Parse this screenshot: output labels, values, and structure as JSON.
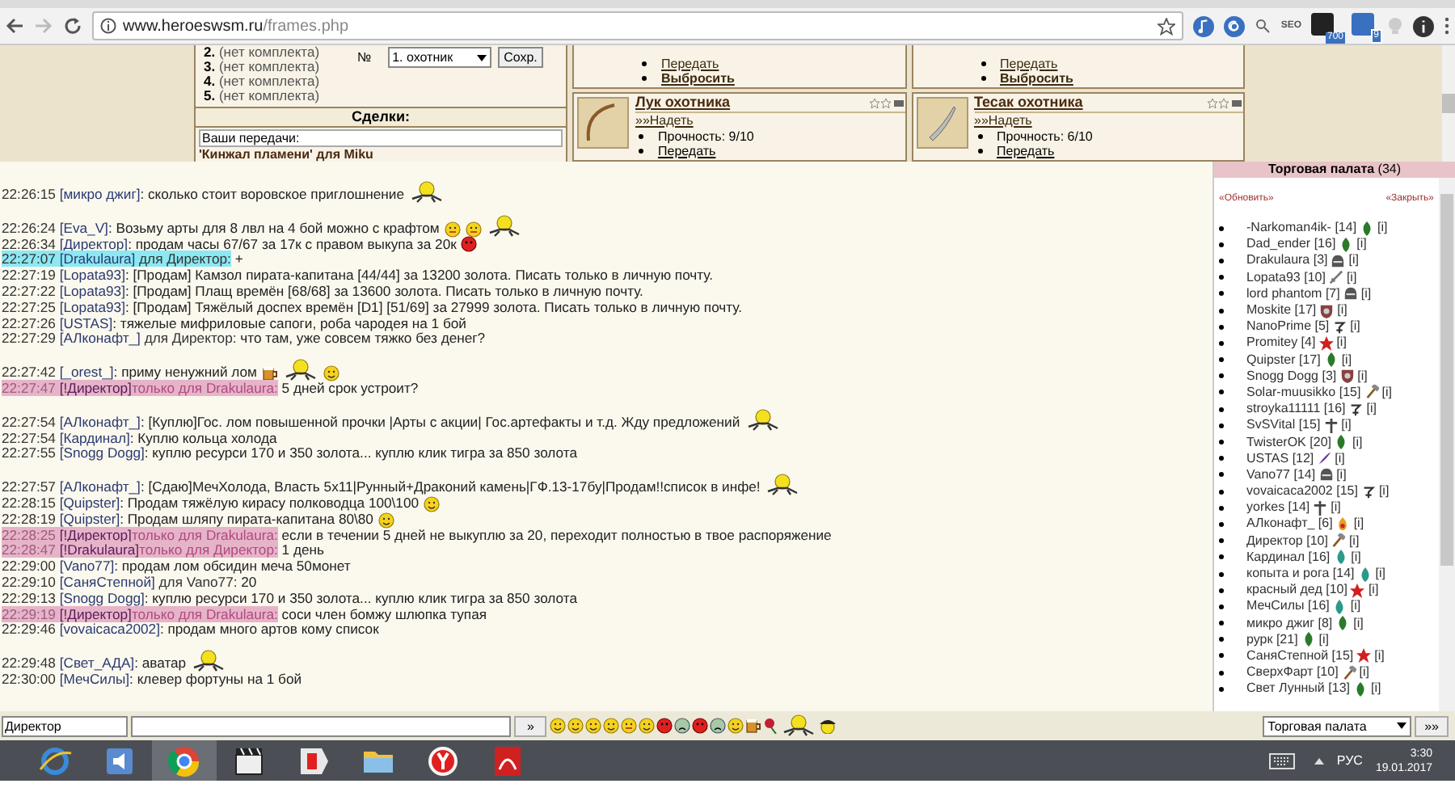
{
  "browser": {
    "url_host": "www.heroeswsm.ru",
    "url_path": "/frames.php",
    "ext_label": "SEO",
    "badges": [
      "700",
      "9"
    ]
  },
  "outfits": {
    "items": [
      {
        "num": "2.",
        "text": "(нет комплекта)"
      },
      {
        "num": "3.",
        "text": "(нет комплекта)"
      },
      {
        "num": "4.",
        "text": "(нет комплекта)"
      },
      {
        "num": "5.",
        "text": "(нет комплекта)"
      }
    ],
    "num_label": "№",
    "select": "1. охотник",
    "save": "Сохр.",
    "deals_title": "Сделки:",
    "transfers": "Ваши передачи:",
    "transfer_item": "'Кинжал пламени' для Miku"
  },
  "items_top": [
    {
      "actions": [
        "Передать",
        "Выбросить"
      ]
    },
    {
      "actions": [
        "Передать",
        "Выбросить"
      ]
    }
  ],
  "items": [
    {
      "name": "Лук охотника",
      "kind": "bow",
      "equip": "»»Надеть",
      "durability": "Прочность: 9/10",
      "action": "Передать"
    },
    {
      "name": "Тесак охотника",
      "kind": "blade",
      "equip": "»»Надеть",
      "durability": "Прочность: 6/10",
      "action": "Передать"
    }
  ],
  "chat_blocks": [
    {
      "messages": [
        {
          "time": "22:26:15",
          "nick": "[микро джиг]",
          "text": ": сколько стоит воровское приглошнение",
          "kind": "public",
          "emotes": [
            {
              "kind": "crawler"
            }
          ]
        }
      ]
    },
    {
      "messages": [
        {
          "time": "22:26:24",
          "nick": "[Eva_V]",
          "text": ": Возьму арты для 8 лвл на 4 бой можно с крафтом",
          "kind": "public",
          "emotes": [
            {
              "kind": "tongue"
            },
            {
              "kind": "tongue"
            },
            {
              "kind": "crawler"
            }
          ]
        },
        {
          "time": "22:26:34",
          "nick": "[Директор]",
          "text": ": продам часы 67/67 за 17к с правом выкупа за 20к",
          "kind": "public",
          "emotes": [
            {
              "kind": "angry"
            }
          ]
        },
        {
          "time": "22:27:07",
          "nick": "[Drakulaura]",
          "to": " для Директор:",
          "text": " +",
          "kind": "mention"
        },
        {
          "time": "22:27:19",
          "nick": "[Lopata93]",
          "text": ": [Продам] Камзол пирата-капитана [44/44] за 13200 золота. Писать только в личную почту.",
          "kind": "public"
        },
        {
          "time": "22:27:22",
          "nick": "[Lopata93]",
          "text": ": [Продам] Плащ времён [68/68] за 13600 золота. Писать только в личную почту.",
          "kind": "public"
        },
        {
          "time": "22:27:25",
          "nick": "[Lopata93]",
          "text": ": [Продам] Тяжёлый доспех времён [D1] [51/69] за 27999 золота. Писать только в личную почту.",
          "kind": "public"
        },
        {
          "time": "22:27:26",
          "nick": "[USTAS]",
          "text": ": тяжелые мифриловые сапоги, роба чародея на 1 бой",
          "kind": "public"
        },
        {
          "time": "22:27:29",
          "nick": "[АЛконафт_]",
          "to": " для Директор:",
          "text": " что там, уже совсем тяжко без денег?",
          "kind": "public"
        }
      ]
    },
    {
      "messages": [
        {
          "time": "22:27:42",
          "nick": "[_orest_]",
          "text": ": приму ненужний лом",
          "kind": "public",
          "emotes": [
            {
              "kind": "beer"
            },
            {
              "kind": "crawler"
            },
            {
              "kind": "smiley"
            }
          ]
        },
        {
          "time": "22:27:47",
          "nick": "[!Директор]",
          "to": "только для Drakulaura:",
          "text": " 5 дней срок устроит?",
          "kind": "private"
        }
      ]
    },
    {
      "messages": [
        {
          "time": "22:27:54",
          "nick": "[АЛконафт_]",
          "text": ": [Куплю]Гос. лом повышенной прочки |Арты с акции| Гос.артефакты и т.д. Жду предложений",
          "kind": "public",
          "emotes": [
            {
              "kind": "crawler"
            }
          ]
        },
        {
          "time": "22:27:54",
          "nick": "[Кардинал]",
          "text": ": Куплю кольца холода",
          "kind": "public"
        },
        {
          "time": "22:27:55",
          "nick": "[Snogg Dogg]",
          "text": ": куплю ресурси 170 и 350 золота... куплю клик тигра за 850 золота",
          "kind": "public"
        }
      ]
    },
    {
      "messages": [
        {
          "time": "22:27:57",
          "nick": "[АЛконафт_]",
          "text": ": [Сдаю]МечХолода, Власть 5х11|Рунный+Драконий камень|ГФ.13-17бу|Продам!!список в инфе!",
          "kind": "public",
          "emotes": [
            {
              "kind": "crawler"
            }
          ]
        },
        {
          "time": "22:28:15",
          "nick": "[Quipster]",
          "text": ": Продам тяжёлую кирасу полководца 100\\100",
          "kind": "public",
          "emotes": [
            {
              "kind": "smiley"
            }
          ]
        },
        {
          "time": "22:28:19",
          "nick": "[Quipster]",
          "text": ": Продам шляпу пирата-капитана 80\\80",
          "kind": "public",
          "emotes": [
            {
              "kind": "smiley"
            }
          ]
        },
        {
          "time": "22:28:25",
          "nick": "[!Директор]",
          "to": "только для Drakulaura:",
          "text": " если в течении 5 дней не выкуплю за 20, переходит полностью в твое распоряжение",
          "kind": "private"
        },
        {
          "time": "22:28:47",
          "nick": "[!Drakulaura]",
          "to": "только для Директор:",
          "text": " 1 день",
          "kind": "private"
        },
        {
          "time": "22:29:00",
          "nick": "[Vano77]",
          "text": ": продам лом обсидин меча 50монет",
          "kind": "public"
        },
        {
          "time": "22:29:10",
          "nick": "[СаняСтепной]",
          "to": " для Vano77:",
          "text": " 20",
          "kind": "public"
        },
        {
          "time": "22:29:13",
          "nick": "[Snogg Dogg]",
          "text": ": куплю ресурси 170 и 350 золота... куплю клик тигра за 850 золота",
          "kind": "public"
        },
        {
          "time": "22:29:19",
          "nick": "[!Директор]",
          "to": "только для Drakulaura:",
          "text": " соси член бомжу шлюпка тупая",
          "kind": "private"
        },
        {
          "time": "22:29:46",
          "nick": "[vovaicaca2002]",
          "text": ": продам много артов кому список",
          "kind": "public"
        }
      ]
    },
    {
      "messages": [
        {
          "time": "22:29:48",
          "nick": "[Свет_АДА]",
          "text": ": аватар",
          "kind": "public",
          "emotes": [
            {
              "kind": "crawler"
            }
          ]
        },
        {
          "time": "22:30:00",
          "nick": "[МечСилы]",
          "text": ": клевер фортуны на 1 бой",
          "kind": "public"
        }
      ]
    }
  ],
  "room": {
    "title": "Торговая палата",
    "count": "(34)",
    "refresh": "«Обновить»",
    "close": "«Закрыть»",
    "players": [
      {
        "name": "-Narkoman4ik-",
        "level": "[14]",
        "kind": "leaf",
        "info": "[i]"
      },
      {
        "name": "Dad_ender",
        "level": "[16]",
        "kind": "leaf",
        "info": "[i]"
      },
      {
        "name": "Drakulaura",
        "level": "[3]",
        "kind": "helmet",
        "info": "[i]"
      },
      {
        "name": "Lopata93",
        "level": "[10]",
        "kind": "sword",
        "info": "[i]"
      },
      {
        "name": "lord phantom",
        "level": "[7]",
        "kind": "helmet",
        "info": "[i]"
      },
      {
        "name": "Moskite",
        "level": "[17]",
        "kind": "shield",
        "info": "[i]"
      },
      {
        "name": "NanoPrime",
        "level": "[5]",
        "kind": "hook",
        "info": "[i]"
      },
      {
        "name": "Promitey",
        "level": "[4]",
        "kind": "star",
        "info": "[i]"
      },
      {
        "name": "Quipster",
        "level": "[17]",
        "kind": "leaf",
        "info": "[i]"
      },
      {
        "name": "Snogg Dogg",
        "level": "[3]",
        "kind": "shield",
        "info": "[i]"
      },
      {
        "name": "Solar-muusikko",
        "level": "[15]",
        "kind": "hammer",
        "info": "[i]"
      },
      {
        "name": "stroyka11111",
        "level": "[16]",
        "kind": "hook",
        "info": "[i]"
      },
      {
        "name": "SvSVital",
        "level": "[15]",
        "kind": "cross",
        "info": "[i]"
      },
      {
        "name": "TwisterOK",
        "level": "[20]",
        "kind": "leaf",
        "info": "[i]"
      },
      {
        "name": "USTAS",
        "level": "[12]",
        "kind": "quill",
        "info": "[i]"
      },
      {
        "name": "Vano77",
        "level": "[14]",
        "kind": "helmet",
        "info": "[i]"
      },
      {
        "name": "vovaicaca2002",
        "level": "[15]",
        "kind": "hook",
        "info": "[i]"
      },
      {
        "name": "yorkes",
        "level": "[14]",
        "kind": "cross",
        "info": "[i]"
      },
      {
        "name": "АЛконафт_",
        "level": "[6]",
        "kind": "flame",
        "info": "[i]"
      },
      {
        "name": "Директор",
        "level": "[10]",
        "kind": "hammer",
        "info": "[i]"
      },
      {
        "name": "Кардинал",
        "level": "[16]",
        "kind": "drop",
        "info": "[i]"
      },
      {
        "name": "копыта и рога",
        "level": "[14]",
        "kind": "drop",
        "info": "[i]"
      },
      {
        "name": "красный дед",
        "level": "[10]",
        "kind": "star",
        "info": "[i]"
      },
      {
        "name": "МечСилы",
        "level": "[16]",
        "kind": "drop",
        "info": "[i]"
      },
      {
        "name": "микро джиг",
        "level": "[8]",
        "kind": "leaf",
        "info": "[i]"
      },
      {
        "name": "рурк",
        "level": "[21]",
        "kind": "leaf",
        "info": "[i]"
      },
      {
        "name": "СаняСтепной",
        "level": "[15]",
        "kind": "star",
        "info": "[i]"
      },
      {
        "name": "СверхФарт",
        "level": "[10]",
        "kind": "hammer",
        "info": "[i]"
      },
      {
        "name": "Свет Лунный",
        "level": "[13]",
        "kind": "leaf",
        "info": "[i]"
      }
    ]
  },
  "input_bar": {
    "recipient": "Директор",
    "send": "»",
    "emotes": [
      {
        "kind": "smiley"
      },
      {
        "kind": "smiley"
      },
      {
        "kind": "grin"
      },
      {
        "kind": "cool"
      },
      {
        "kind": "tongue"
      },
      {
        "kind": "shades"
      },
      {
        "kind": "angry"
      },
      {
        "kind": "sad"
      },
      {
        "kind": "angry"
      },
      {
        "kind": "sad"
      },
      {
        "kind": "smiley"
      },
      {
        "kind": "beer"
      },
      {
        "kind": "flower"
      },
      {
        "kind": "crawler"
      },
      {
        "kind": "cap"
      }
    ],
    "room_select": "Торговая палата",
    "go": "»»"
  },
  "taskbar": {
    "apps": [
      {
        "kind": "swirl",
        "selected": false
      },
      {
        "kind": "speaker",
        "selected": false
      },
      {
        "kind": "wheel",
        "selected": true
      },
      {
        "kind": "clapper",
        "selected": false
      },
      {
        "kind": "tag",
        "selected": false
      },
      {
        "kind": "folder",
        "selected": false
      },
      {
        "kind": "redcircle",
        "selected": false
      },
      {
        "kind": "document",
        "selected": false
      }
    ],
    "lang": "РУС",
    "time": "3:30",
    "date": "19.01.2017"
  }
}
